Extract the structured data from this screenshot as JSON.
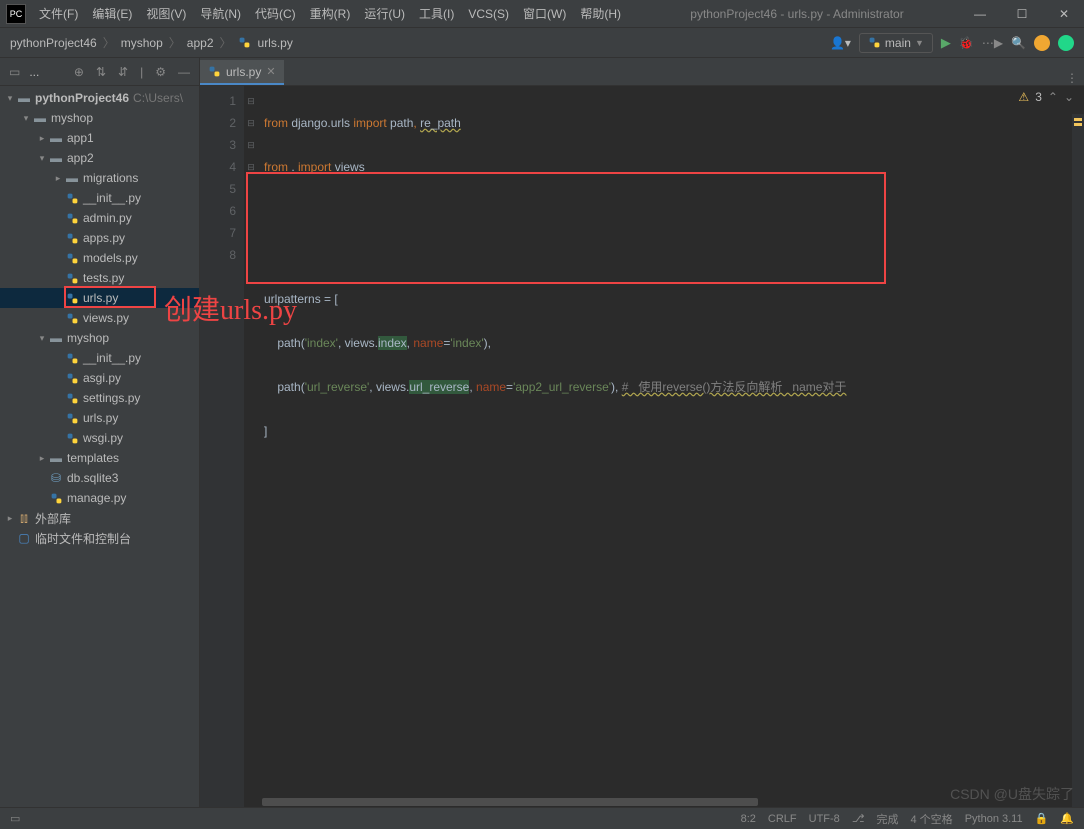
{
  "titlebar": {
    "menus": [
      "文件(F)",
      "编辑(E)",
      "视图(V)",
      "导航(N)",
      "代码(C)",
      "重构(R)",
      "运行(U)",
      "工具(I)",
      "VCS(S)",
      "窗口(W)",
      "帮助(H)"
    ],
    "title": "pythonProject46 - urls.py - Administrator"
  },
  "breadcrumbs": [
    "pythonProject46",
    "myshop",
    "app2",
    "urls.py"
  ],
  "runConfig": "main",
  "projectPanel": {
    "label": "..."
  },
  "tree": {
    "root": {
      "name": "pythonProject46",
      "path": "C:\\Users\\"
    },
    "myshop": "myshop",
    "app1": "app1",
    "app2": "app2",
    "migrations": "migrations",
    "files_app2": [
      "__init__.py",
      "admin.py",
      "apps.py",
      "models.py",
      "tests.py",
      "urls.py",
      "views.py"
    ],
    "myshop_inner": "myshop",
    "files_myshop": [
      "__init__.py",
      "asgi.py",
      "settings.py",
      "urls.py",
      "wsgi.py"
    ],
    "templates": "templates",
    "db": "db.sqlite3",
    "manage": "manage.py",
    "external": "外部库",
    "scratches": "临时文件和控制台"
  },
  "tab": {
    "name": "urls.py"
  },
  "warnings": "3",
  "code": {
    "line1a": "from",
    "line1b": " django.urls ",
    "line1c": "import",
    "line1d": " path",
    "line1e": ", ",
    "line1f": "re_path",
    "line2a": "from",
    "line2b": " . ",
    "line2c": "import",
    "line2d": " views",
    "line5a": "urlpatterns = [",
    "line6a": "    path(",
    "line6b": "'index'",
    "line6c": ", ",
    "line6d": "views.",
    "line6e": "index",
    "line6f": ", ",
    "line6g": "name",
    "line6h": "=",
    "line6i": "'index'",
    "line6j": "),",
    "line7a": "    path(",
    "line7b": "'url_reverse'",
    "line7c": ", ",
    "line7d": "views.",
    "line7e": "url_reverse",
    "line7f": ", ",
    "line7g": "name",
    "line7h": "=",
    "line7i": "'app2_url_reverse'",
    "line7j": "), ",
    "line7k": "#   使用reverse()方法反向解析   name对于",
    "line8a": "]"
  },
  "annotation": "创建urls.py",
  "status": {
    "pos": "8:2",
    "eol": "CRLF",
    "encoding": "UTF-8",
    "vcs": "完成",
    "spaces": "4 个空格",
    "python": "Python 3.11"
  },
  "watermark": "CSDN @U盘失踪了"
}
